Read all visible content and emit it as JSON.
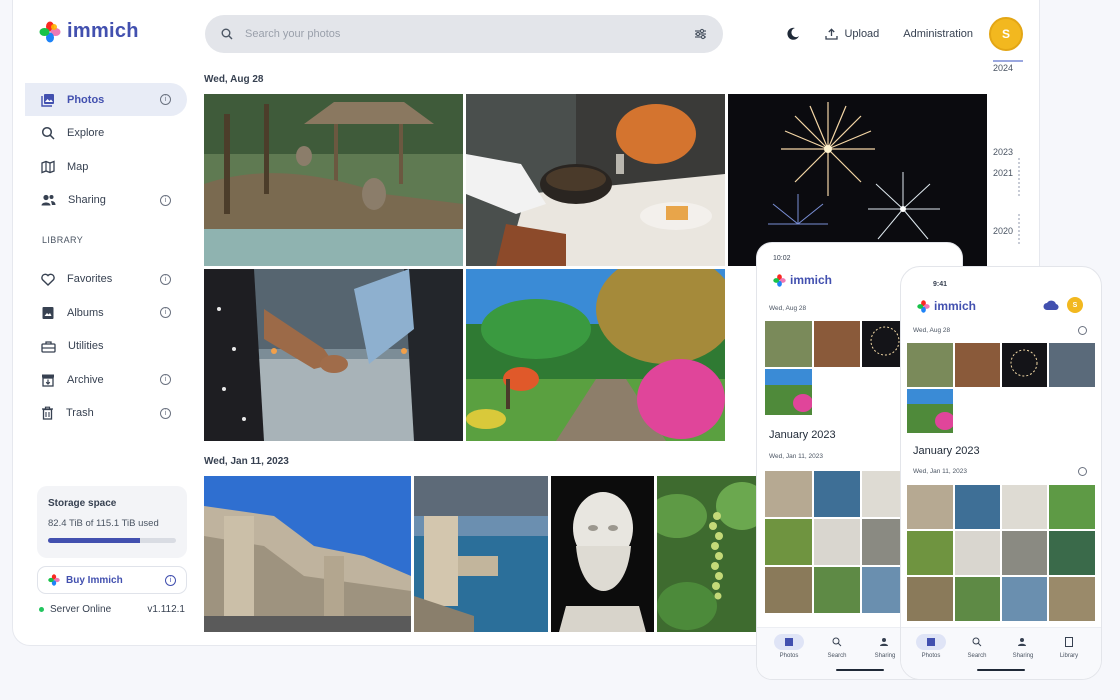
{
  "app": {
    "name": "immich"
  },
  "search": {
    "placeholder": "Search your photos"
  },
  "header": {
    "upload_label": "Upload",
    "admin_label": "Administration",
    "avatar_letter": "S"
  },
  "sidebar": {
    "items": [
      {
        "label": "Photos",
        "icon": "photos-icon",
        "active": true,
        "info": true
      },
      {
        "label": "Explore",
        "icon": "search-icon",
        "info": false
      },
      {
        "label": "Map",
        "icon": "map-icon",
        "info": false
      },
      {
        "label": "Sharing",
        "icon": "people-icon",
        "info": true
      }
    ],
    "library_heading": "LIBRARY",
    "library_items": [
      {
        "label": "Favorites",
        "icon": "heart-icon",
        "info": true
      },
      {
        "label": "Albums",
        "icon": "album-icon",
        "info": true
      },
      {
        "label": "Utilities",
        "icon": "toolbox-icon",
        "info": false
      },
      {
        "label": "Archive",
        "icon": "archive-icon",
        "info": true
      },
      {
        "label": "Trash",
        "icon": "trash-icon",
        "info": true
      }
    ]
  },
  "storage": {
    "title": "Storage space",
    "used_text": "82.4 TiB of 115.1 TiB used",
    "used_fraction": 0.716
  },
  "buy": {
    "label": "Buy Immich"
  },
  "server": {
    "status": "Server Online",
    "version": "v1.112.1"
  },
  "groups": [
    {
      "date": "Wed, Aug 28"
    },
    {
      "date": "Wed, Jan 11, 2023"
    }
  ],
  "timeline": {
    "years": [
      "2024",
      "2023",
      "2021",
      "2020"
    ]
  },
  "phone_android": {
    "status_time": "10:02",
    "brand": "immich",
    "date1": "Wed, Aug 28",
    "month": "January 2023",
    "date2": "Wed, Jan 11, 2023",
    "nav": [
      "Photos",
      "Search",
      "Sharing"
    ]
  },
  "phone_ios": {
    "status_time": "9:41",
    "brand": "immich",
    "date1": "Wed, Aug 28",
    "month": "January 2023",
    "date2": "Wed, Jan 11, 2023",
    "nav": [
      "Photos",
      "Search",
      "Sharing",
      "Library"
    ]
  },
  "colors": {
    "accent": "#4250af",
    "avatar": "#f2b81f",
    "online": "#22c55e"
  }
}
